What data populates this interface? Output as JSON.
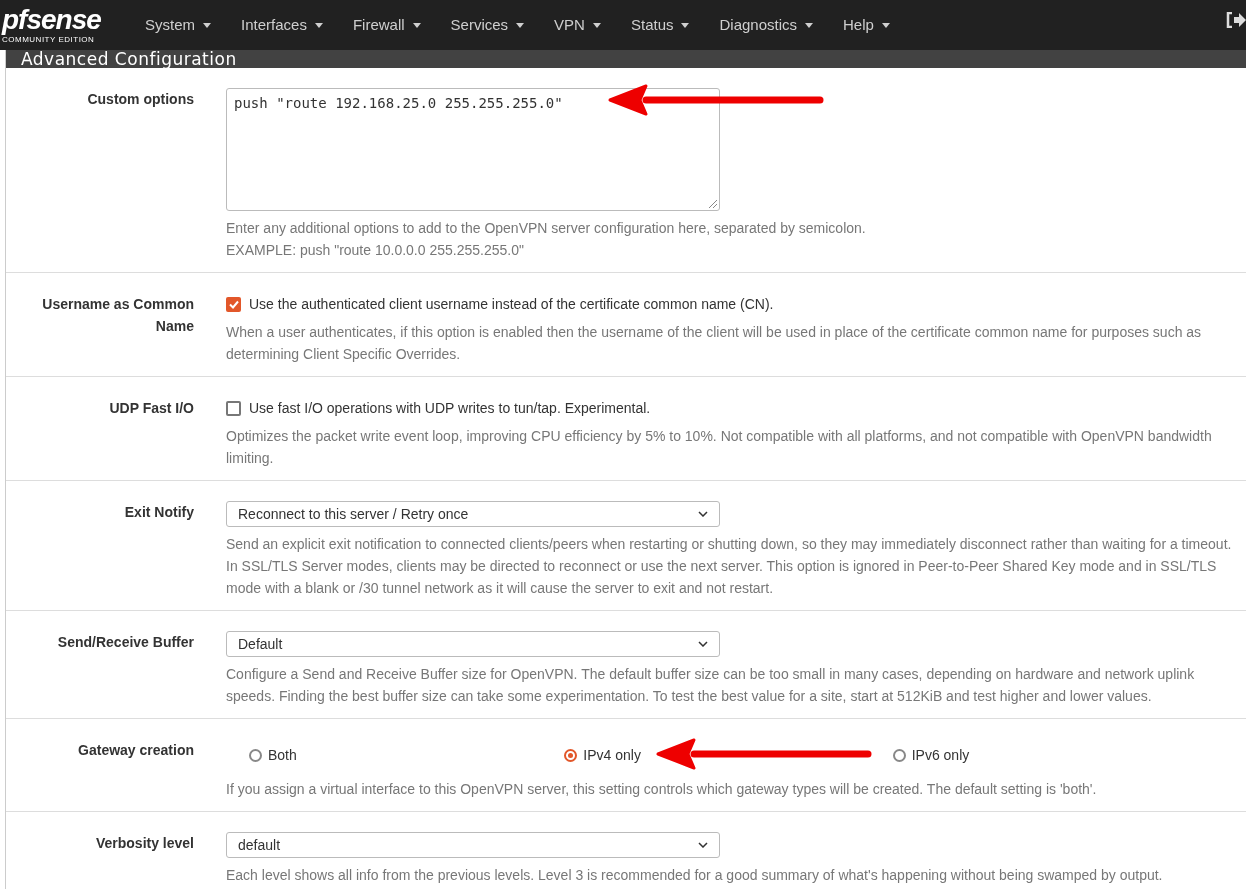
{
  "brand": {
    "logo": "pfsense",
    "edition": "COMMUNITY EDITION"
  },
  "nav": [
    "System",
    "Interfaces",
    "Firewall",
    "Services",
    "VPN",
    "Status",
    "Diagnostics",
    "Help"
  ],
  "panel": {
    "title": "Advanced Configuration"
  },
  "rows": [
    {
      "kind": "textarea",
      "label": "Custom options",
      "value": "push \"route 192.168.25.0 255.255.255.0\"",
      "help": [
        "Enter any additional options to add to the OpenVPN server configuration here, separated by semicolon.",
        "EXAMPLE: push \"route 10.0.0.0 255.255.255.0\""
      ],
      "annotated": true
    },
    {
      "kind": "checkbox",
      "label": "Username as Common Name",
      "checked": true,
      "text": "Use the authenticated client username instead of the certificate common name (CN).",
      "help": [
        "When a user authenticates, if this option is enabled then the username of the client will be used in place of the certificate common name for purposes such as determining Client Specific Overrides."
      ]
    },
    {
      "kind": "checkbox",
      "label": "UDP Fast I/O",
      "checked": false,
      "text": "Use fast I/O operations with UDP writes to tun/tap. Experimental.",
      "help": [
        "Optimizes the packet write event loop, improving CPU efficiency by 5% to 10%. Not compatible with all platforms, and not compatible with OpenVPN bandwidth limiting."
      ]
    },
    {
      "kind": "select",
      "label": "Exit Notify",
      "value": "Reconnect to this server / Retry once",
      "help": [
        "Send an explicit exit notification to connected clients/peers when restarting or shutting down, so they may immediately disconnect rather than waiting for a timeout. In SSL/TLS Server modes, clients may be directed to reconnect or use the next server. This option is ignored in Peer-to-Peer Shared Key mode and in SSL/TLS mode with a blank or /30 tunnel network as it will cause the server to exit and not restart."
      ]
    },
    {
      "kind": "select",
      "label": "Send/Receive Buffer",
      "value": "Default",
      "help": [
        "Configure a Send and Receive Buffer size for OpenVPN. The default buffer size can be too small in many cases, depending on hardware and network uplink speeds. Finding the best buffer size can take some experimentation. To test the best value for a site, start at 512KiB and test higher and lower values."
      ]
    },
    {
      "kind": "radio",
      "label": "Gateway creation",
      "options": [
        {
          "label": "Both",
          "selected": false
        },
        {
          "label": "IPv4 only",
          "selected": true,
          "annotated": true
        },
        {
          "label": "IPv6 only",
          "selected": false
        }
      ],
      "help": [
        "If you assign a virtual interface to this OpenVPN server, this setting controls which gateway types will be created. The default setting is 'both'."
      ]
    },
    {
      "kind": "select",
      "label": "Verbosity level",
      "value": "default",
      "help": [
        "Each level shows all info from the previous levels. Level 3 is recommended for a good summary of what's happening without being swamped by output."
      ]
    }
  ]
}
